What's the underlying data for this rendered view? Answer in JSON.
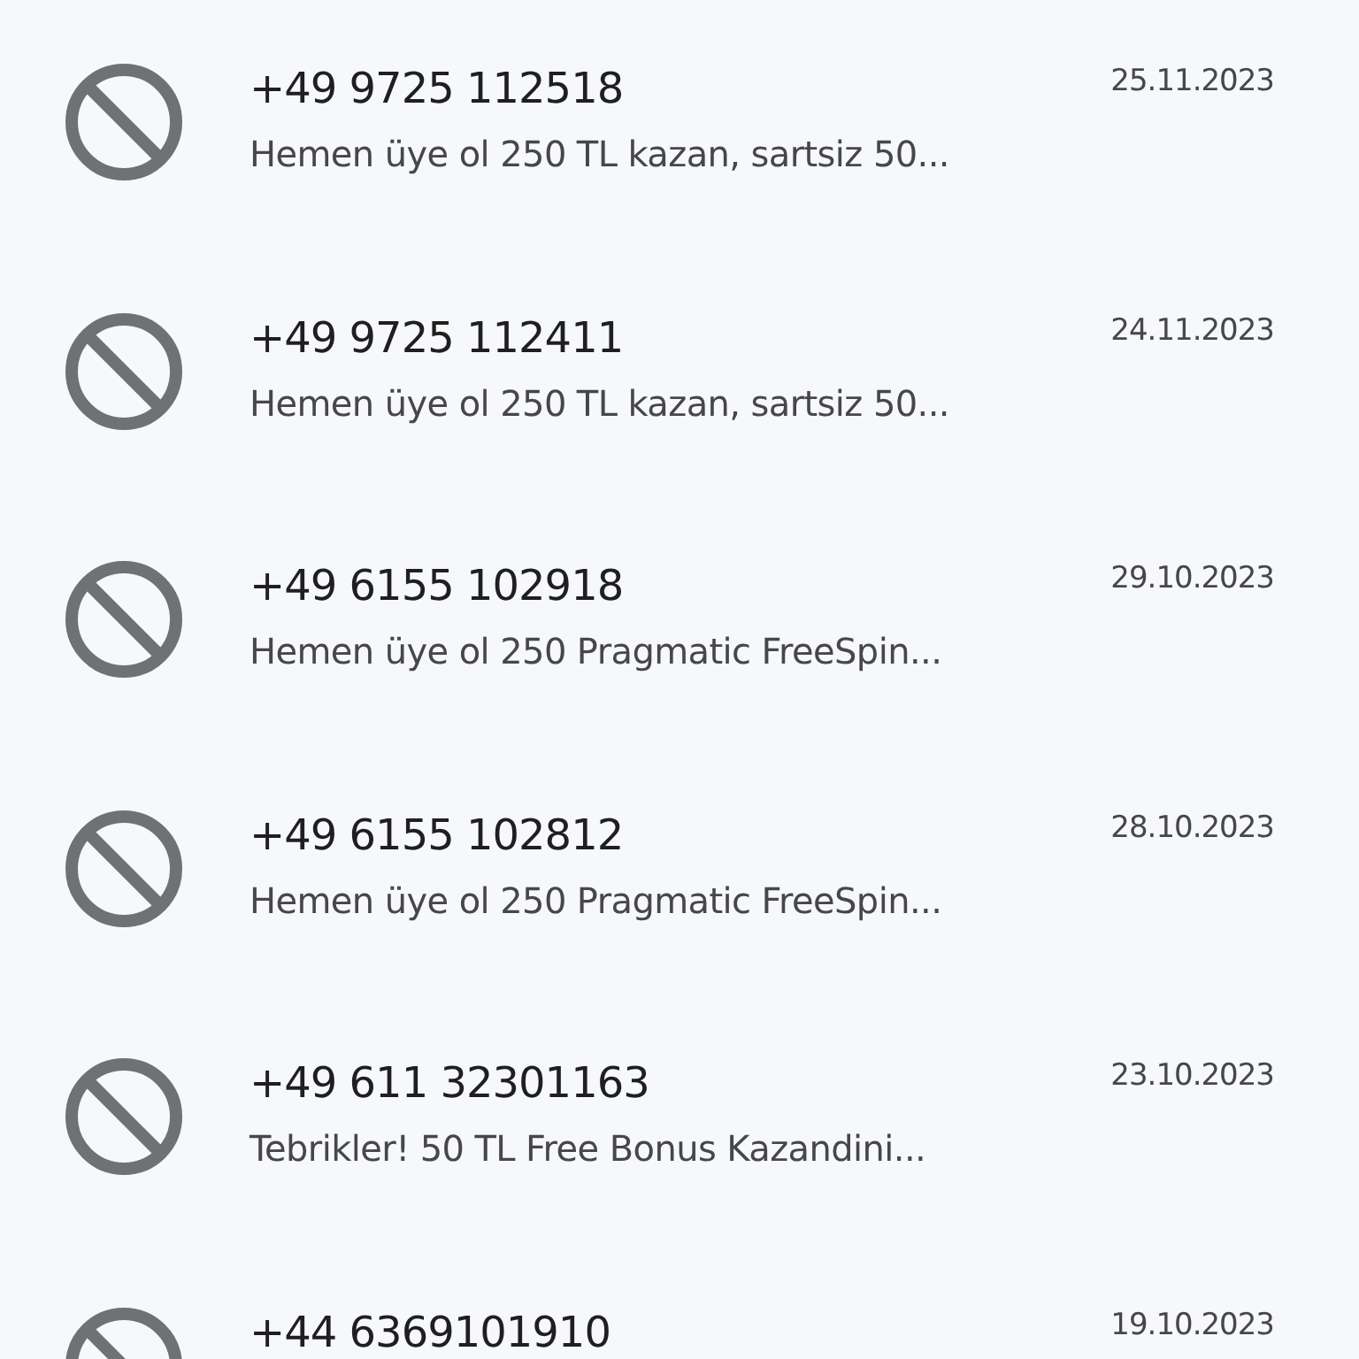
{
  "conversations": [
    {
      "sender": "+49 9725 112518",
      "preview": "Hemen üye ol 250 TL kazan, sartsiz 50...",
      "date": "25.11.2023",
      "blocked": true
    },
    {
      "sender": "+49 9725 112411",
      "preview": "Hemen üye ol 250 TL kazan, sartsiz 50...",
      "date": "24.11.2023",
      "blocked": true
    },
    {
      "sender": "+49 6155 102918",
      "preview": "Hemen üye ol 250 Pragmatic FreeSpin...",
      "date": "29.10.2023",
      "blocked": true
    },
    {
      "sender": "+49 6155 102812",
      "preview": "Hemen üye ol 250 Pragmatic FreeSpin...",
      "date": "28.10.2023",
      "blocked": true
    },
    {
      "sender": "+49 611 32301163",
      "preview": "Tebrikler! 50 TL Free Bonus Kazandini...",
      "date": "23.10.2023",
      "blocked": true
    },
    {
      "sender": "+44 6369101910",
      "date": "19.10.2023",
      "blocked": true
    }
  ]
}
